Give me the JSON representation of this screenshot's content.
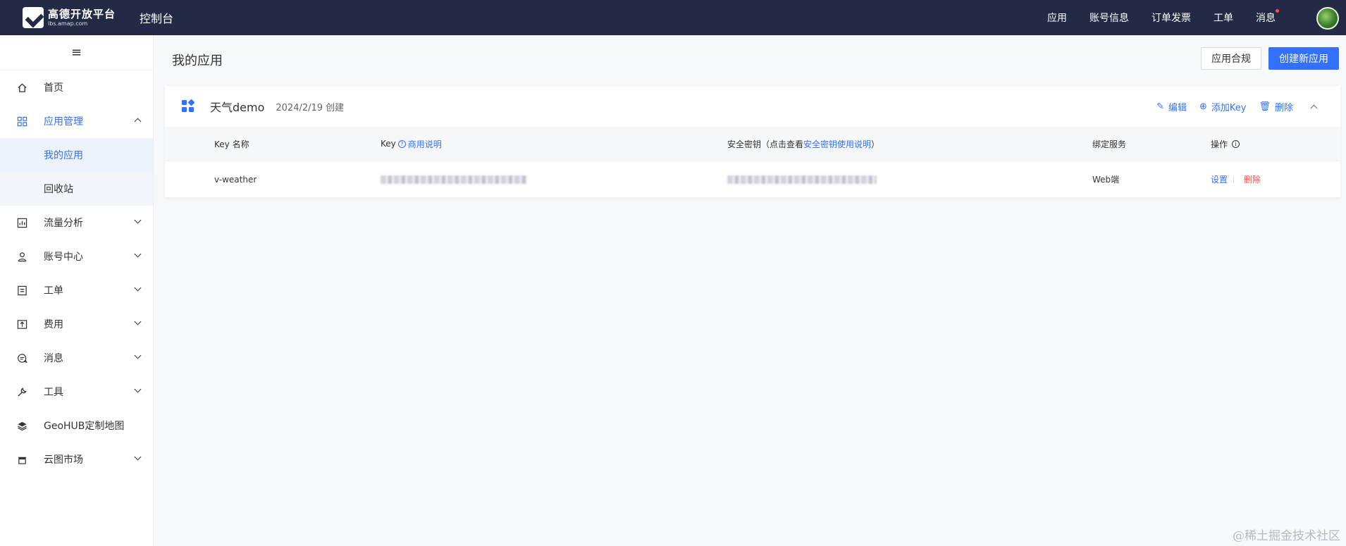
{
  "header": {
    "logo_cn": "高德开放平台",
    "logo_en": "lbs.amap.com",
    "console": "控制台",
    "nav": [
      "应用",
      "账号信息",
      "订单发票",
      "工单",
      "消息"
    ]
  },
  "sidebar": {
    "collapse": "≡",
    "items": [
      {
        "label": "首页",
        "icon": "home-icon"
      },
      {
        "label": "应用管理",
        "icon": "grid-icon"
      },
      {
        "label": "流量分析",
        "icon": "chart-icon"
      },
      {
        "label": "账号中心",
        "icon": "user-icon"
      },
      {
        "label": "工单",
        "icon": "ticket-icon"
      },
      {
        "label": "费用",
        "icon": "billing-icon"
      },
      {
        "label": "消息",
        "icon": "message-icon"
      },
      {
        "label": "工具",
        "icon": "wrench-icon"
      },
      {
        "label": "GeoHUB定制地图",
        "icon": "layers-icon"
      },
      {
        "label": "云图市场",
        "icon": "store-icon"
      }
    ],
    "sub_items": [
      "我的应用",
      "回收站"
    ]
  },
  "main": {
    "title": "我的应用",
    "compliance_button": "应用合规",
    "create_button": "创建新应用"
  },
  "app": {
    "name": "天气demo",
    "created": "2024/2/19 创建",
    "actions": {
      "edit": "编辑",
      "add_key": "添加Key",
      "delete": "删除"
    },
    "columns": {
      "key_name": "Key 名称",
      "key": "Key",
      "key_help": "商用说明",
      "secret_prefix": "安全密钥（点击查看",
      "secret_link": "安全密钥使用说明",
      "secret_suffix": "）",
      "service": "绑定服务",
      "ops": "操作"
    },
    "rows": [
      {
        "key_name": "v-weather",
        "service": "Web端",
        "setting": "设置",
        "delete": "删除"
      }
    ]
  },
  "watermark": "@稀土掘金技术社区",
  "colors": {
    "primary": "#3370ff",
    "header_bg": "#222a45",
    "danger": "#ff4d4f"
  }
}
